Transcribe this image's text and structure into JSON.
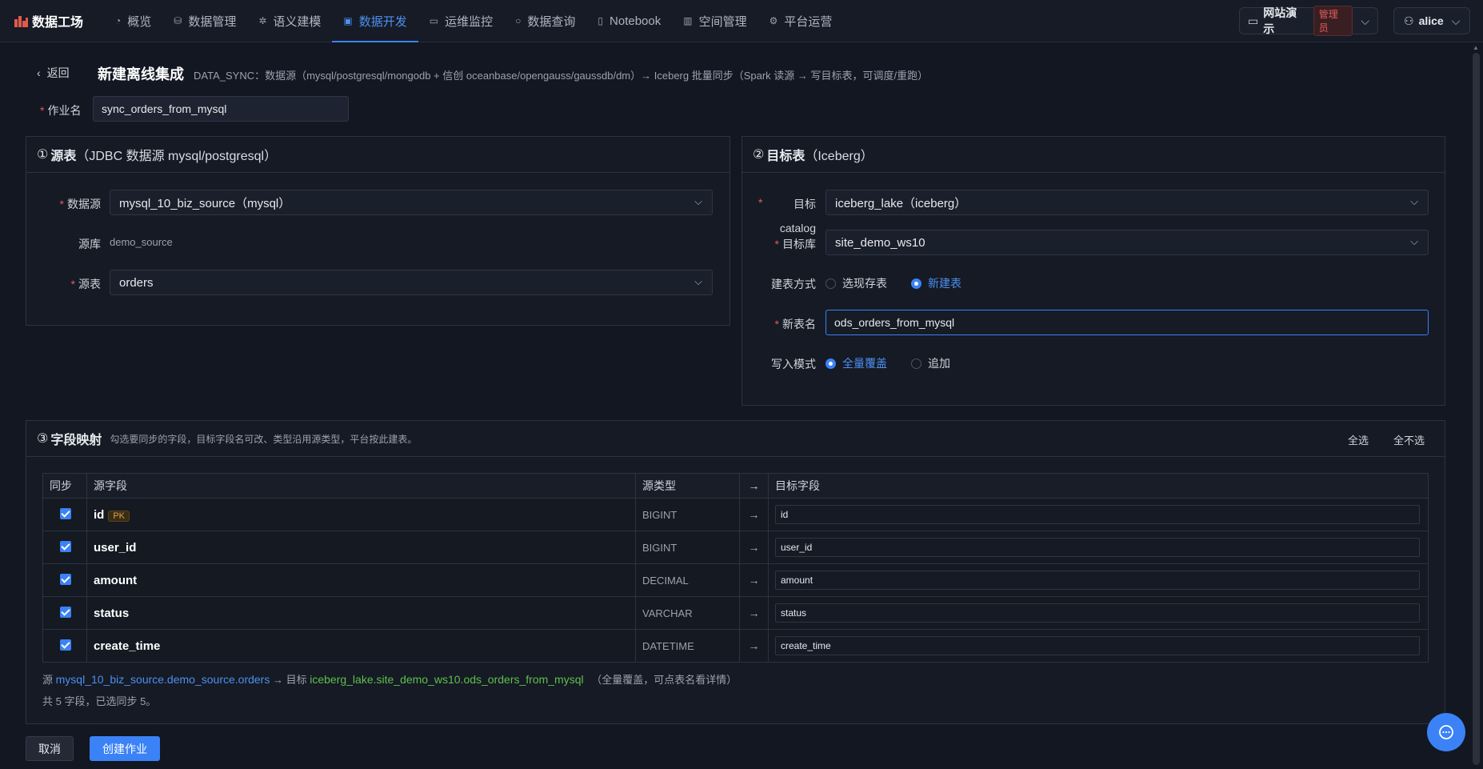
{
  "nav": {
    "brand": "数据工场",
    "items": [
      {
        "icon": "dashboard-icon",
        "glyph": "◔",
        "label": "概览"
      },
      {
        "icon": "database-icon",
        "glyph": "⛁",
        "label": "数据管理"
      },
      {
        "icon": "semantic-icon",
        "glyph": "✲",
        "label": "语义建模"
      },
      {
        "icon": "dev-icon",
        "glyph": "▣",
        "label": "数据开发",
        "active": true
      },
      {
        "icon": "monitor-icon",
        "glyph": "▭",
        "label": "运维监控"
      },
      {
        "icon": "search-icon",
        "glyph": "○",
        "label": "数据查询"
      },
      {
        "icon": "notebook-icon",
        "glyph": "▯",
        "label": "Notebook"
      },
      {
        "icon": "building-icon",
        "glyph": "▥",
        "label": "空间管理"
      },
      {
        "icon": "gear-icon",
        "glyph": "⚙",
        "label": "平台运营"
      }
    ],
    "workspace": {
      "name": "网站演示",
      "badge": "管理员"
    },
    "user": "alice"
  },
  "header": {
    "back": "返回",
    "title": "新建离线集成",
    "desc": "DATA_SYNC：数据源（mysql/postgresql/mongodb + 信创 oceanbase/opengauss/gaussdb/dm）→ Iceberg 批量同步（Spark 读源 → 写目标表，可调度/重跑）"
  },
  "job": {
    "label": "作业名",
    "value": "sync_orders_from_mysql"
  },
  "source": {
    "num": "①",
    "title": "源表",
    "subtitle": "（JDBC 数据源 mysql/postgresql）",
    "datasource_label": "数据源",
    "datasource_value": "mysql_10_biz_source（mysql）",
    "db_label": "源库",
    "db_value": "demo_source",
    "table_label": "源表",
    "table_value": "orders"
  },
  "target": {
    "num": "②",
    "title": "目标表",
    "subtitle": "（Iceberg）",
    "catalog_label_top": "目标",
    "catalog_label": "catalog",
    "catalog_value": "iceberg_lake（iceberg）",
    "db_label": "目标库",
    "db_value": "site_demo_ws10",
    "mode_label": "建表方式",
    "mode_options": [
      "选现存表",
      "新建表"
    ],
    "mode_selected": "新建表",
    "newtable_label": "新表名",
    "newtable_value": "ods_orders_from_mysql",
    "write_label": "写入模式",
    "write_options": [
      "全量覆盖",
      "追加"
    ],
    "write_selected": "全量覆盖"
  },
  "mapping": {
    "num": "③",
    "title": "字段映射",
    "hint": "勾选要同步的字段，目标字段名可改、类型沿用源类型，平台按此建表。",
    "select_all": "全选",
    "select_none": "全不选",
    "columns": [
      "同步",
      "源字段",
      "源类型",
      "→",
      "目标字段"
    ],
    "rows": [
      {
        "checked": true,
        "source": "id",
        "pk": "PK",
        "type": "BIGINT",
        "arrow": "→",
        "target": "id"
      },
      {
        "checked": true,
        "source": "user_id",
        "type": "BIGINT",
        "arrow": "→",
        "target": "user_id"
      },
      {
        "checked": true,
        "source": "amount",
        "type": "DECIMAL",
        "arrow": "→",
        "target": "amount"
      },
      {
        "checked": true,
        "source": "status",
        "type": "VARCHAR",
        "arrow": "→",
        "target": "status"
      },
      {
        "checked": true,
        "source": "create_time",
        "type": "DATETIME",
        "arrow": "→",
        "target": "create_time"
      }
    ],
    "summary_prefix": "源",
    "summary_source": "mysql_10_biz_source.demo_source.orders",
    "summary_mid": "→ 目标",
    "summary_target": "iceberg_lake.site_demo_ws10.ods_orders_from_mysql",
    "summary_note": "（全量覆盖，可点表名看详情）",
    "count_text": "共 5 字段，已选同步 5。"
  },
  "actions": {
    "cancel": "取消",
    "create": "创建作业"
  },
  "colors": {
    "accent": "#3b82f6",
    "link": "#4d8ff0",
    "target_link": "#5fbf4f",
    "required": "#e35b5b"
  }
}
